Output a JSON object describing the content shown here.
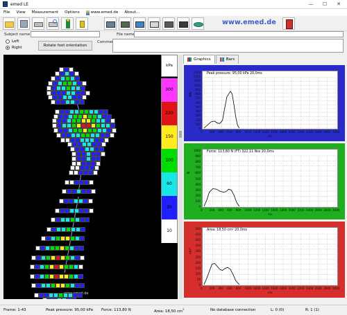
{
  "window": {
    "title": "emed LE",
    "controls": {
      "minimize": "—",
      "maximize": "☐",
      "close": "✕"
    }
  },
  "menu": [
    "File",
    "View",
    "Measurement",
    "Options",
    "www.emed.de",
    "About..."
  ],
  "toolbar": {
    "logo_text": "www.emed.de",
    "buttons": [
      "open-folder",
      "save",
      "print",
      "print-preview",
      "run-person",
      "walk-person",
      "analysis-1",
      "analysis-2",
      "analysis-3",
      "analysis-4",
      "analysis-5",
      "analysis-6",
      "analysis-7",
      "exit-door"
    ]
  },
  "form": {
    "subject_label": "Subject name :",
    "subject_value": "",
    "file_label": "File name :",
    "file_value": "",
    "comment_label": "Comment :",
    "comment_value": "",
    "left_label": "Left",
    "right_label": "Right",
    "selected_side": "Right",
    "rotate_button": "Rotate foot orientation"
  },
  "pressure_map": {
    "footer_text": "www.emed.de",
    "unit": "kPa"
  },
  "legend": {
    "unit": "kPa",
    "steps": [
      {
        "label": "300",
        "color": "#ff36ff"
      },
      {
        "label": "220",
        "color": "#e01414"
      },
      {
        "label": "150",
        "color": "#ffeb1e"
      },
      {
        "label": "100",
        "color": "#00dd00"
      },
      {
        "label": "60",
        "color": "#19e6e6"
      },
      {
        "label": "30",
        "color": "#1f1fff"
      },
      {
        "label": "10",
        "color": "#ffffff"
      }
    ]
  },
  "tabs": [
    {
      "label": "Graphics",
      "active": true,
      "icon": "chart-icon"
    },
    {
      "label": "Bars",
      "active": false,
      "icon": "bars-icon"
    }
  ],
  "charts": [
    {
      "caption": "Peak pressure: 95,00 kPa 20,0ms",
      "ylabel": "kPa",
      "xlabel": "ms",
      "bg": "#2a2ac8",
      "yticks": [
        "1300",
        "1200",
        "1100",
        "1000",
        "900",
        "800",
        "700",
        "600",
        "500",
        "400",
        "300",
        "200",
        "100",
        "0"
      ]
    },
    {
      "caption": "Force: 113,80 N (FT) 322,11 Nss 20,0ms",
      "ylabel": "N",
      "xlabel": "ms",
      "bg": "#1fae1f",
      "yticks": [
        "1000",
        "900",
        "800",
        "700",
        "600",
        "500",
        "400",
        "300",
        "200",
        "100",
        "0"
      ]
    },
    {
      "caption": "Area: 18,50 cm² 20,0ms",
      "ylabel": "cm²",
      "xlabel": "ms",
      "bg": "#d62d2d",
      "yticks": [
        "500",
        "450",
        "400",
        "350",
        "300",
        "250",
        "200",
        "150",
        "100",
        "50",
        "0"
      ]
    }
  ],
  "x_ticks": [
    "0",
    "200",
    "400",
    "600",
    "800",
    "1000",
    "1200",
    "1400",
    "1600",
    "1800",
    "2000",
    "2200",
    "2400",
    "2600",
    "2800",
    "3000"
  ],
  "chart_data": [
    {
      "type": "line",
      "title": "Peak pressure: 95,00 kPa 20,0ms",
      "ylabel": "kPa",
      "xlabel": "ms",
      "x": [
        0,
        80,
        160,
        240,
        300,
        360,
        420,
        460,
        520,
        600,
        640,
        680,
        720,
        760,
        800
      ],
      "y": [
        0,
        80,
        160,
        180,
        130,
        120,
        200,
        450,
        800,
        950,
        880,
        600,
        300,
        80,
        0
      ],
      "xlim": [
        0,
        3000
      ],
      "ylim": [
        0,
        1300
      ]
    },
    {
      "type": "line",
      "title": "Force: 113,80 N (FT) 322,11 Nss 20,0ms",
      "ylabel": "N",
      "xlabel": "ms",
      "x": [
        0,
        60,
        120,
        200,
        280,
        360,
        440,
        500,
        560,
        620,
        680,
        740,
        800
      ],
      "y": [
        0,
        120,
        280,
        350,
        340,
        300,
        280,
        290,
        340,
        320,
        220,
        80,
        0
      ],
      "xlim": [
        0,
        3000
      ],
      "ylim": [
        0,
        1000
      ]
    },
    {
      "type": "line",
      "title": "Area: 18,50 cm² 20,0ms",
      "ylabel": "cm²",
      "xlabel": "ms",
      "x": [
        0,
        60,
        120,
        180,
        240,
        300,
        360,
        420,
        480,
        540,
        600,
        660,
        720,
        800
      ],
      "y": [
        0,
        60,
        130,
        200,
        210,
        180,
        150,
        140,
        160,
        170,
        150,
        100,
        40,
        0
      ],
      "xlim": [
        0,
        3000
      ],
      "ylim": [
        0,
        500
      ]
    }
  ],
  "status": {
    "frame": "Frame: 1-43",
    "peak": "Peak pressure: 95,00 kPa",
    "force": "Force: 113,80 N",
    "area_prefix": "Area: 18,50 cm",
    "area_sup": "2",
    "db": "No database connection",
    "l": "L: 0 (0)",
    "r": "R: 1 (1)"
  }
}
